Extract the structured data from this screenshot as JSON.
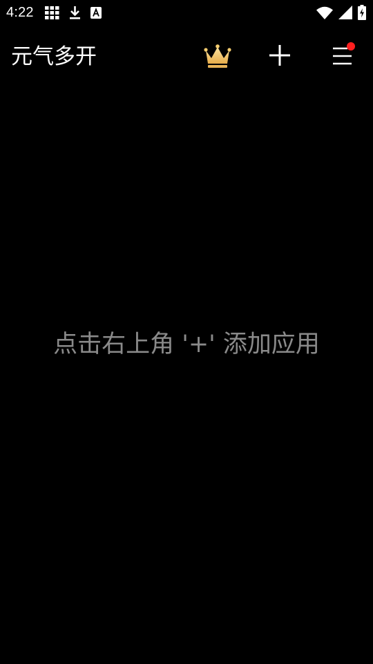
{
  "status_bar": {
    "time": "4:22",
    "left_icons": [
      "apps-grid-icon",
      "download-icon",
      "accessibility-a-icon"
    ],
    "right_icons": [
      "wifi-icon",
      "cell-signal-icon",
      "battery-charging-icon"
    ]
  },
  "app_bar": {
    "title": "元气多开",
    "actions": [
      "crown-icon",
      "plus-icon",
      "menu-icon"
    ],
    "menu_has_notification": true
  },
  "empty_state": {
    "message": "点击右上角 '+' 添加应用"
  },
  "colors": {
    "background": "#000000",
    "text_primary": "#ffffff",
    "text_hint": "#8a8a8a",
    "crown": "#f5c96a",
    "notification_dot": "#ff1f1f"
  }
}
